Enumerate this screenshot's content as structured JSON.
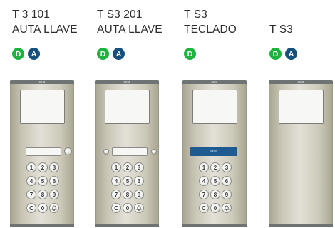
{
  "products": [
    {
      "title_line1": "T 3 101",
      "title_line2": "AUTA LLAVE",
      "badges": [
        "D",
        "A"
      ],
      "panel_brand": "auta",
      "has_reader": true,
      "has_left_led": false,
      "has_right_led": true,
      "has_keypad": true,
      "label_plate": null
    },
    {
      "title_line1": "T S3 201",
      "title_line2": "AUTA LLAVE",
      "badges": [
        "D",
        "A"
      ],
      "panel_brand": "auta",
      "has_reader": true,
      "has_left_led": true,
      "has_right_led": true,
      "has_keypad": true,
      "label_plate": null
    },
    {
      "title_line1": "T S3",
      "title_line2": "TECLADO",
      "badges": [
        "D"
      ],
      "panel_brand": "auta",
      "has_reader": false,
      "has_left_led": false,
      "has_right_led": false,
      "has_keypad": true,
      "label_plate": "auta"
    },
    {
      "title_line1": "",
      "title_line2": "T S3",
      "badges": [
        "D",
        "A"
      ],
      "panel_brand": "auta",
      "has_reader": false,
      "has_left_led": false,
      "has_right_led": false,
      "has_keypad": false,
      "label_plate": null
    }
  ],
  "keypad_keys": [
    "1",
    "2",
    "3",
    "4",
    "5",
    "6",
    "7",
    "8",
    "9",
    "C",
    "0",
    "bell-icon"
  ],
  "badge_colors": {
    "D": "#1db33f",
    "A": "#15517f"
  }
}
